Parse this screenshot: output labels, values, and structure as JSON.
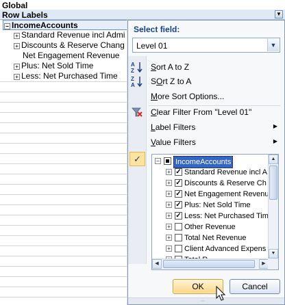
{
  "pivot": {
    "title": "Global",
    "row_labels_header": "Row Labels",
    "header_dropdown_glyph": "▼",
    "root_row": {
      "toggle": "−",
      "label": "IncomeAccounts"
    },
    "rows": [
      {
        "toggle": "+",
        "label": "Standard Revenue incl Admi"
      },
      {
        "toggle": "+",
        "label": "Discounts & Reserve Chang"
      },
      {
        "toggle": "",
        "label": "Net Engagement Revenue"
      },
      {
        "toggle": "+",
        "label": "Plus: Net Sold Time"
      },
      {
        "toggle": "+",
        "label": "Less: Net Purchased Time"
      }
    ]
  },
  "panel": {
    "select_field_label": "Select field:",
    "select_field_value": "Level 01",
    "select_dropdown_glyph": "▼",
    "menu": {
      "sort_az": {
        "underline": "S",
        "rest": "ort A to Z",
        "icon": "A→Z"
      },
      "sort_za": {
        "underline": "O",
        "pre": "S",
        "rest": "rt Z to A",
        "icon": "Z→A"
      },
      "more_sort": {
        "underline": "M",
        "rest": "ore Sort Options..."
      },
      "clear_filter": {
        "underline": "C",
        "rest": "lear Filter From \"Level 01\""
      },
      "label_filters": {
        "underline": "L",
        "rest": "abel Filters",
        "arrow": "▶"
      },
      "value_filters": {
        "underline": "V",
        "rest": "alue Filters",
        "arrow": "▶"
      }
    },
    "checkmark_glyph": "✓",
    "tree": {
      "root": {
        "toggle": "−",
        "label": "IncomeAccounts",
        "check_state": "partial"
      },
      "items": [
        {
          "toggle": "+",
          "label": "Standard Revenue incl A",
          "checked": true
        },
        {
          "toggle": "+",
          "label": "Discounts & Reserve Ch",
          "checked": true
        },
        {
          "toggle": "+",
          "label": "Net Engagement Revenu",
          "checked": true
        },
        {
          "toggle": "+",
          "label": "Plus: Net Sold Time",
          "checked": true
        },
        {
          "toggle": "+",
          "label": "Less: Net Purchased Tim",
          "checked": true
        },
        {
          "toggle": "+",
          "label": "Other Revenue",
          "checked": false
        },
        {
          "toggle": "+",
          "label": "Total Net Revenue",
          "checked": false
        },
        {
          "toggle": "+",
          "label": "Client Advanced Expens",
          "checked": false
        },
        {
          "toggle": "+",
          "label": "Total R...",
          "checked": false
        }
      ],
      "scroll_up": "▲",
      "scroll_down": "▼",
      "scroll_left": "◀",
      "scroll_right": "▶"
    },
    "ok_button": "OK",
    "cancel_button": "Cancel",
    "resize_grip": "⋯"
  },
  "colors": {
    "header_blue": "#15428b",
    "selection_blue": "#3565c4",
    "ok_highlight": "#fbd581",
    "checkmark_bg": "#fde3a0"
  }
}
